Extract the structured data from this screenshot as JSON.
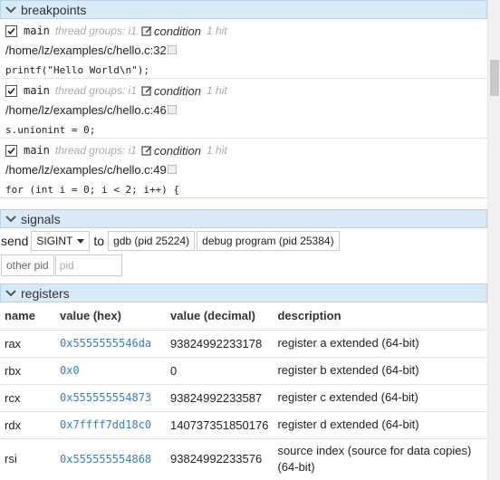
{
  "breakpoints": {
    "title": "breakpoints",
    "items": [
      {
        "function": "main",
        "thread_groups": "thread groups: i1",
        "condition_label": "condition",
        "hits": "1 hit",
        "location": "/home/lz/examples/c/hello.c:32",
        "source": "printf(\"Hello World\\n\");",
        "enabled": true
      },
      {
        "function": "main",
        "thread_groups": "thread groups: i1",
        "condition_label": "condition",
        "hits": "1 hit",
        "location": "/home/lz/examples/c/hello.c:46",
        "source": "s.unionint = 0;",
        "enabled": true
      },
      {
        "function": "main",
        "thread_groups": "thread groups: i1",
        "condition_label": "condition",
        "hits": "1 hit",
        "location": "/home/lz/examples/c/hello.c:49",
        "source": "for (int i = 0; i < 2; i++) {",
        "enabled": true
      }
    ]
  },
  "signals": {
    "title": "signals",
    "send_label": "send",
    "signal_value": "SIGINT",
    "to_label": "to",
    "target_gdb": "gdb (pid 25224)",
    "target_program": "debug program (pid 25384)",
    "other_pid_label": "other pid",
    "pid_placeholder": "pid"
  },
  "registers": {
    "title": "registers",
    "columns": [
      "name",
      "value (hex)",
      "value (decimal)",
      "description"
    ],
    "rows": [
      {
        "name": "rax",
        "hex": "0x5555555546da",
        "decimal": "93824992233178",
        "description": "register a extended (64-bit)"
      },
      {
        "name": "rbx",
        "hex": "0x0",
        "decimal": "0",
        "description": "register b extended (64-bit)"
      },
      {
        "name": "rcx",
        "hex": "0x555555554873",
        "decimal": "93824992233587",
        "description": "register c extended (64-bit)"
      },
      {
        "name": "rdx",
        "hex": "0x7ffff7dd18c0",
        "decimal": "140737351850176",
        "description": "register d extended (64-bit)"
      },
      {
        "name": "rsi",
        "hex": "0x555555554868",
        "decimal": "93824992233576",
        "description": "source index (source for data copies) (64-bit)"
      }
    ]
  },
  "colors": {
    "header_bg": "#d9eaf7",
    "hex_value": "#3a7dbf"
  },
  "icons": {
    "collapse": "chevron-down-icon",
    "checkbox": "checkbox-checked-icon",
    "condition": "edit-icon"
  }
}
